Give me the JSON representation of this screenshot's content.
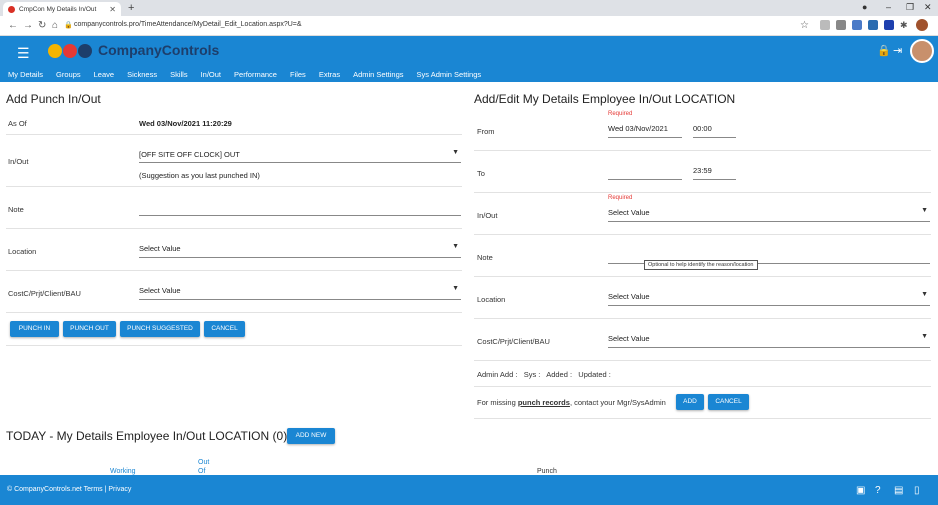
{
  "browser": {
    "tab_title": "CmpCon My Details In/Out",
    "url": "companycontrols.pro/TimeAttendance/MyDetail_Edit_Location.aspx?U=&"
  },
  "app": {
    "brand": "CompanyControls",
    "logo_colors": [
      "#f5b400",
      "#e53935",
      "#1d3e6b"
    ],
    "accent": "#1a86d3",
    "menu": [
      "My Details",
      "Groups",
      "Leave",
      "Sickness",
      "Skills",
      "In/Out",
      "Performance",
      "Files",
      "Extras",
      "Admin Settings",
      "Sys Admin Settings"
    ]
  },
  "left": {
    "title": "Add Punch In/Out",
    "as_of_label": "As Of",
    "as_of_value": "Wed 03/Nov/2021 11:20:29",
    "inout_label": "In/Out",
    "inout_value": "[OFF SITE OFF CLOCK] OUT",
    "suggestion": "(Suggestion as you last punched IN)",
    "note_label": "Note",
    "location_label": "Location",
    "location_value": "Select Value",
    "cost_label": "CostC/Prjt/Client/BAU",
    "cost_value": "Select Value",
    "buttons": [
      "PUNCH IN",
      "PUNCH OUT",
      "PUNCH SUGGESTED",
      "CANCEL"
    ]
  },
  "right": {
    "title": "Add/Edit My Details Employee In/Out LOCATION",
    "required": "Required",
    "from_label": "From",
    "from_date": "Wed 03/Nov/2021",
    "from_time": "00:00",
    "to_label": "To",
    "to_time": "23:59",
    "inout_label": "In/Out",
    "inout_value": "Select Value",
    "note_label": "Note",
    "note_tooltip": "Optional to help identify the reason/location",
    "location_label": "Location",
    "location_value": "Select Value",
    "cost_label": "CostC/Prjt/Client/BAU",
    "cost_value": "Select Value",
    "audit": "Admin Add :   Sys :   Added :   Updated :",
    "missing_pre": "For missing ",
    "missing_link": "punch records",
    "missing_post": ", contact your Mgr/SysAdmin",
    "add_btn": "ADD",
    "cancel_btn": "CANCEL"
  },
  "today": {
    "title": "TODAY - My Details Employee In/Out LOCATION (0)",
    "add_new": "ADD NEW",
    "col_working": "Working",
    "col_out": "Out",
    "col_of": "Of",
    "col_punch": "Punch"
  },
  "footer": {
    "text": "© CompanyControls.net Terms | Privacy"
  }
}
